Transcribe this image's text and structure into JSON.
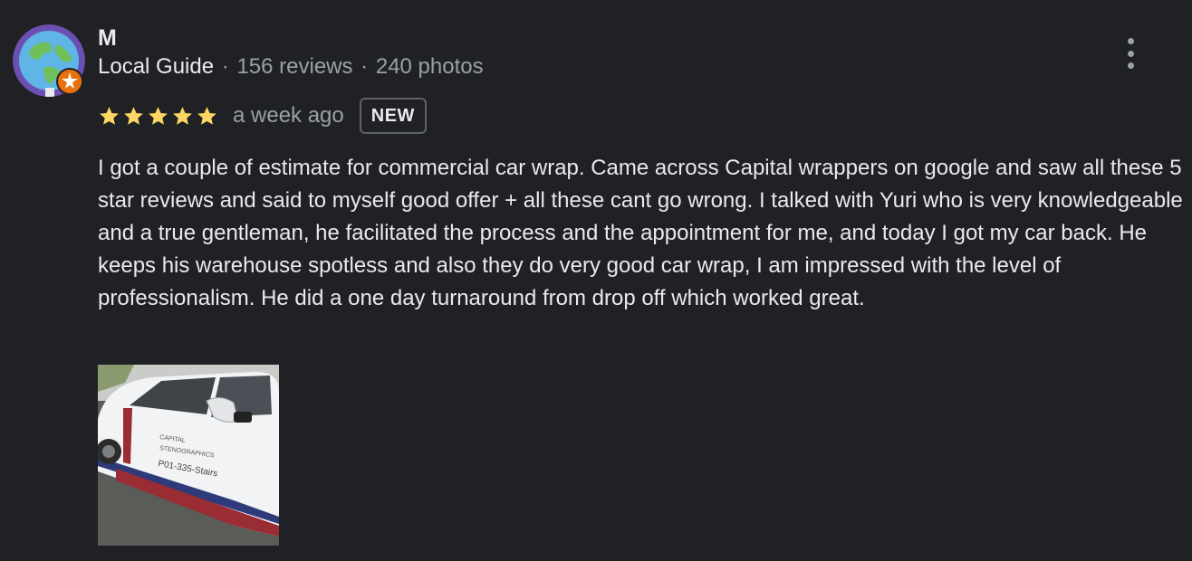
{
  "reviewer": {
    "name": "M",
    "guide_label": "Local Guide",
    "separator": "·",
    "reviews": "156 reviews",
    "photos": "240 photos"
  },
  "rating": {
    "stars": 5,
    "time": "a week ago",
    "badge": "NEW"
  },
  "review": {
    "text": "I got a couple of estimate for commercial car wrap. Came across Capital wrappers on google and saw all these 5 star reviews and said to myself good offer + all these cant go wrong. I talked with Yuri who is very knowledgeable and a true gentleman, he facilitated the process and the appointment for me, and today I got my car back. He keeps his warehouse spotless and also they do very good car wrap, I am impressed with the level of professionalism. He did a one day turnaround from drop off which worked great."
  },
  "photo": {
    "door_text_1": "CAPITAL",
    "door_text_2": "STENOGRAPHICS",
    "door_text_3": "P01-335-Stairs"
  },
  "icons": {
    "avatar": "globe-icon",
    "badge": "local-guide-badge-icon",
    "star": "star-icon",
    "more": "more-vert-icon"
  },
  "colors": {
    "background": "#202124",
    "star": "#fdd663",
    "badge": "#e8710a",
    "secondary_text": "#9aa0a6"
  }
}
